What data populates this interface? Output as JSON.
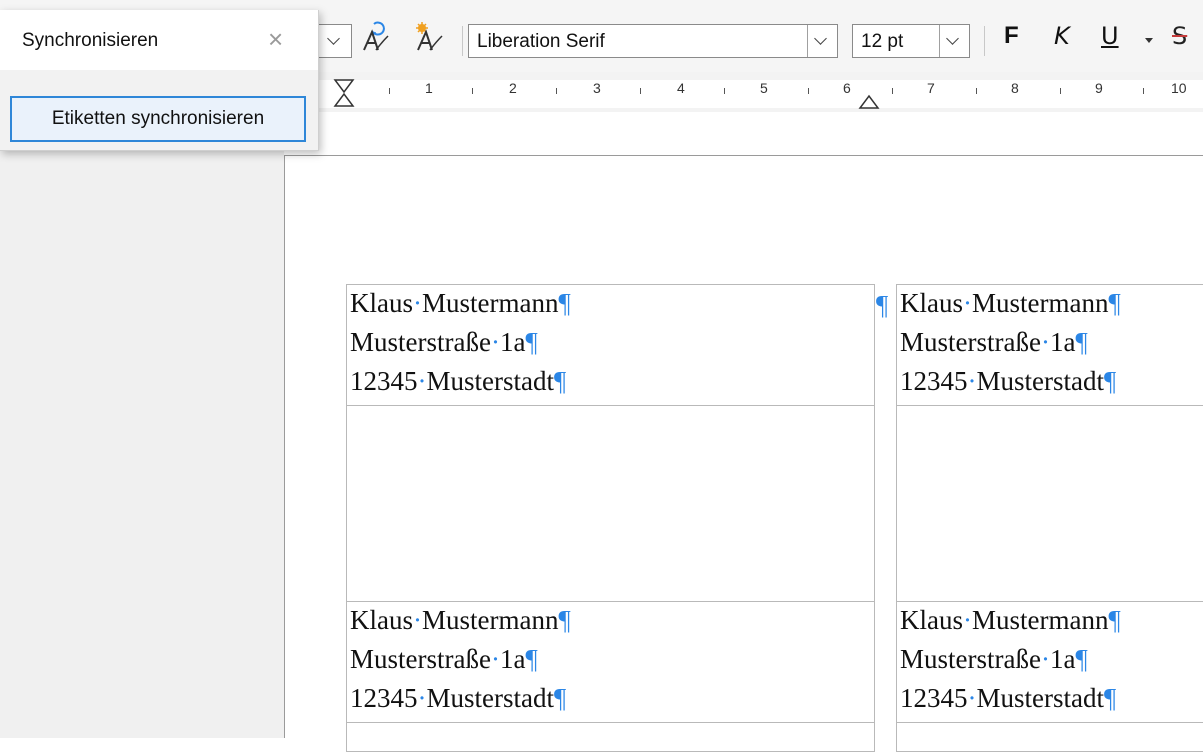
{
  "toolbar": {
    "font_name": "Liberation Serif",
    "font_size": "12 pt",
    "bold_label": "F",
    "italic_label": "K",
    "underline_label": "U",
    "strike_label": "S"
  },
  "float_window": {
    "title": "Synchronisieren",
    "close_glyph": "×",
    "button_label": "Etiketten synchronisieren"
  },
  "ruler": {
    "numbers": [
      "1",
      "2",
      "3",
      "4",
      "5",
      "6",
      "7",
      "8",
      "9",
      "10"
    ]
  },
  "labels": [
    {
      "line1": "Klaus",
      "line1b": "Mustermann",
      "line2": "Musterstraße",
      "line2b": "1a",
      "line3": "12345",
      "line3b": "Musterstadt"
    },
    {
      "line1": "Klaus",
      "line1b": "Mustermann",
      "line2": "Musterstraße",
      "line2b": "1a",
      "line3": "12345",
      "line3b": "Musterstadt"
    },
    {
      "line1": "Klaus",
      "line1b": "Mustermann",
      "line2": "Musterstraße",
      "line2b": "1a",
      "line3": "12345",
      "line3b": "Musterstadt"
    },
    {
      "line1": "Klaus",
      "line1b": "Mustermann",
      "line2": "Musterstraße",
      "line2b": "1a",
      "line3": "12345",
      "line3b": "Musterstadt"
    }
  ],
  "marks": {
    "space_dot": "·",
    "pilcrow": "¶"
  },
  "colors": {
    "formatting_marks": "#2b86e6",
    "button_border": "#2f87d8"
  },
  "icons": [
    "update-style-icon",
    "new-style-icon",
    "close-icon",
    "chevron-down-icon"
  ]
}
